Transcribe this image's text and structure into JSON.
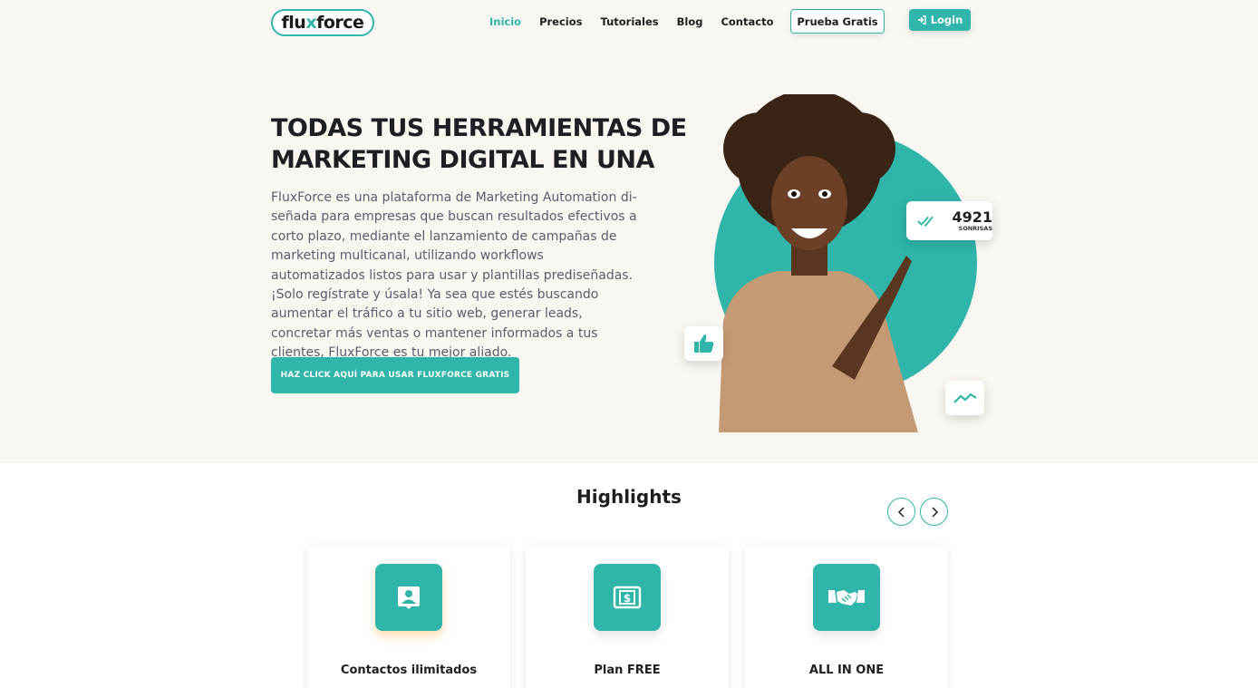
{
  "header": {
    "logo": {
      "part1": "flu",
      "part2": "x",
      "part3": "force"
    },
    "nav": [
      {
        "label": "Inicio",
        "active": true
      },
      {
        "label": "Precios"
      },
      {
        "label": "Tutoriales"
      },
      {
        "label": "Blog"
      },
      {
        "label": "Contacto"
      }
    ],
    "language_flag": "uk-flag-icon",
    "trial_button": "Prueba Gratis",
    "login_button": "Login"
  },
  "hero": {
    "title_line1": "TODAS TUS HERRAMIENTAS DE",
    "title_line2": "MARKETING DIGITAL EN UNA",
    "description": "FluxForce es una plataforma de Marketing Automation di-señada para empresas que buscan resultados efectivos a corto plazo, mediante el lanzamiento de campañas de marketing multicanal, utilizando workflows automatizados listos para usar y plantillas prediseñadas. ¡Solo regístrate y úsala! Ya sea que estés buscando aumentar el tráfico a tu sitio web, generar leads, concretar más ventas o mantener informados a tus clientes, FluxForce es tu mejor aliado.",
    "cta": "HAZ CLICK AQUÍ PARA USAR FLUXFORCE GRATIS",
    "badge_count": "4921",
    "badge_label": "SONRISAS"
  },
  "highlights": {
    "title": "Highlights",
    "cards": [
      {
        "title": "Contactos ilimitados",
        "icon": "contact-icon"
      },
      {
        "title": "Plan FREE",
        "icon": "dollar-bill-icon"
      },
      {
        "title": "ALL IN ONE",
        "icon": "handshake-icon"
      }
    ]
  },
  "colors": {
    "accent": "#2fb5a9",
    "hero_bg": "#faf7f2",
    "text_dark": "#1f1f23"
  }
}
